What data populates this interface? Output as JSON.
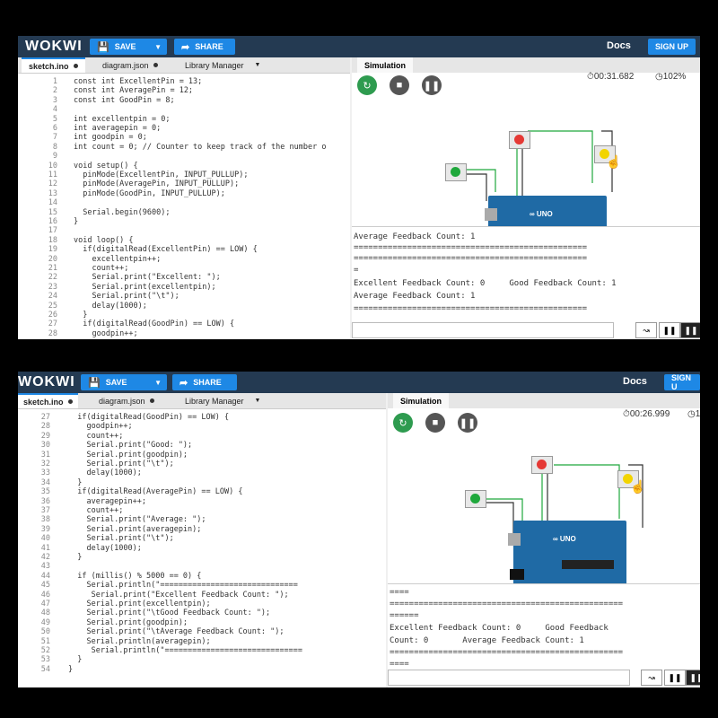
{
  "app": {
    "logo": "WOKWI",
    "save_label": "SAVE",
    "share_label": "SHARE",
    "docs_label": "Docs",
    "signup_label": "SIGN UP",
    "signup_label_cut": "SIGN U"
  },
  "tabs": [
    {
      "label": "sketch.ino"
    },
    {
      "label": "diagram.json"
    },
    {
      "label": "Library Manager"
    }
  ],
  "simulation": {
    "tab_label": "Simulation"
  },
  "top": {
    "timer": "00:31.682",
    "speed": "102%",
    "code_lines": [
      {
        "n": "1",
        "t": "const int ExcellentPin = 13;"
      },
      {
        "n": "2",
        "t": "const int AveragePin = 12;"
      },
      {
        "n": "3",
        "t": "const int GoodPin = 8;"
      },
      {
        "n": "4",
        "t": ""
      },
      {
        "n": "5",
        "t": "int excellentpin = 0;"
      },
      {
        "n": "6",
        "t": "int averagepin = 0;"
      },
      {
        "n": "7",
        "t": "int goodpin = 0;"
      },
      {
        "n": "8",
        "t": "int count = 0; // Counter to keep track of the number o"
      },
      {
        "n": "9",
        "t": ""
      },
      {
        "n": "10",
        "t": "void setup() {"
      },
      {
        "n": "11",
        "t": "  pinMode(ExcellentPin, INPUT_PULLUP);"
      },
      {
        "n": "12",
        "t": "  pinMode(AveragePin, INPUT_PULLUP);"
      },
      {
        "n": "13",
        "t": "  pinMode(GoodPin, INPUT_PULLUP);"
      },
      {
        "n": "14",
        "t": ""
      },
      {
        "n": "15",
        "t": "  Serial.begin(9600);"
      },
      {
        "n": "16",
        "t": "}"
      },
      {
        "n": "17",
        "t": ""
      },
      {
        "n": "18",
        "t": "void loop() {"
      },
      {
        "n": "19",
        "t": "  if(digitalRead(ExcellentPin) == LOW) {"
      },
      {
        "n": "20",
        "t": "    excellentpin++;"
      },
      {
        "n": "21",
        "t": "    count++;"
      },
      {
        "n": "22",
        "t": "    Serial.print(\"Excellent: \");"
      },
      {
        "n": "23",
        "t": "    Serial.print(excellentpin);"
      },
      {
        "n": "24",
        "t": "    Serial.print(\"\\t\");"
      },
      {
        "n": "25",
        "t": "    delay(1000);"
      },
      {
        "n": "26",
        "t": "  }"
      },
      {
        "n": "27",
        "t": "  if(digitalRead(GoodPin) == LOW) {"
      },
      {
        "n": "28",
        "t": "    goodpin++;"
      }
    ],
    "serial_lines": [
      "Average Feedback Count: 1",
      "================================================",
      "================================================",
      "=",
      "Excellent Feedback Count: 0     Good Feedback Count: 1",
      "Average Feedback Count: 1",
      "================================================"
    ]
  },
  "bottom": {
    "timer": "00:26.999",
    "speed": "10",
    "code_lines": [
      {
        "n": "27",
        "t": "  if(digitalRead(GoodPin) == LOW) {"
      },
      {
        "n": "28",
        "t": "    goodpin++;"
      },
      {
        "n": "29",
        "t": "    count++;"
      },
      {
        "n": "30",
        "t": "    Serial.print(\"Good: \");"
      },
      {
        "n": "31",
        "t": "    Serial.print(goodpin);"
      },
      {
        "n": "32",
        "t": "    Serial.print(\"\\t\");"
      },
      {
        "n": "33",
        "t": "    delay(1000);"
      },
      {
        "n": "34",
        "t": "  }"
      },
      {
        "n": "35",
        "t": "  if(digitalRead(AveragePin) == LOW) {"
      },
      {
        "n": "36",
        "t": "    averagepin++;"
      },
      {
        "n": "37",
        "t": "    count++;"
      },
      {
        "n": "38",
        "t": "    Serial.print(\"Average: \");"
      },
      {
        "n": "39",
        "t": "    Serial.print(averagepin);"
      },
      {
        "n": "40",
        "t": "    Serial.print(\"\\t\");"
      },
      {
        "n": "41",
        "t": "    delay(1000);"
      },
      {
        "n": "42",
        "t": "  }"
      },
      {
        "n": "43",
        "t": ""
      },
      {
        "n": "44",
        "t": "  if (millis() % 5000 == 0) {"
      },
      {
        "n": "45",
        "t": "    Serial.println(\"=============================="
      },
      {
        "n": "46",
        "t": "     Serial.print(\"Excellent Feedback Count: \");"
      },
      {
        "n": "47",
        "t": "    Serial.print(excellentpin);"
      },
      {
        "n": "48",
        "t": "    Serial.print(\"\\tGood Feedback Count: \");"
      },
      {
        "n": "49",
        "t": "    Serial.print(goodpin);"
      },
      {
        "n": "50",
        "t": "    Serial.print(\"\\tAverage Feedback Count: \");"
      },
      {
        "n": "51",
        "t": "    Serial.println(averagepin);"
      },
      {
        "n": "52",
        "t": "     Serial.println(\"=============================="
      },
      {
        "n": "53",
        "t": "  }"
      },
      {
        "n": "54",
        "t": "}"
      }
    ],
    "serial_lines": [
      "====",
      "================================================",
      "======",
      "Excellent Feedback Count: 0     Good Feedback",
      "Count: 0       Average Feedback Count: 1",
      "================================================",
      "===="
    ]
  },
  "colors": {
    "topbar": "#243a52",
    "accent": "#1e88e5",
    "board": "#1f6aa5",
    "led_green": "#1fa83c",
    "led_red": "#e53935",
    "led_yellow": "#f2d400",
    "run_button": "#2e9b4f",
    "stop_button": "#555555"
  },
  "icons": [
    "save-icon",
    "share-icon",
    "restart-icon",
    "stop-icon",
    "pause-icon",
    "timer-icon",
    "speed-icon",
    "plot-icon",
    "pause-serial-icon"
  ]
}
